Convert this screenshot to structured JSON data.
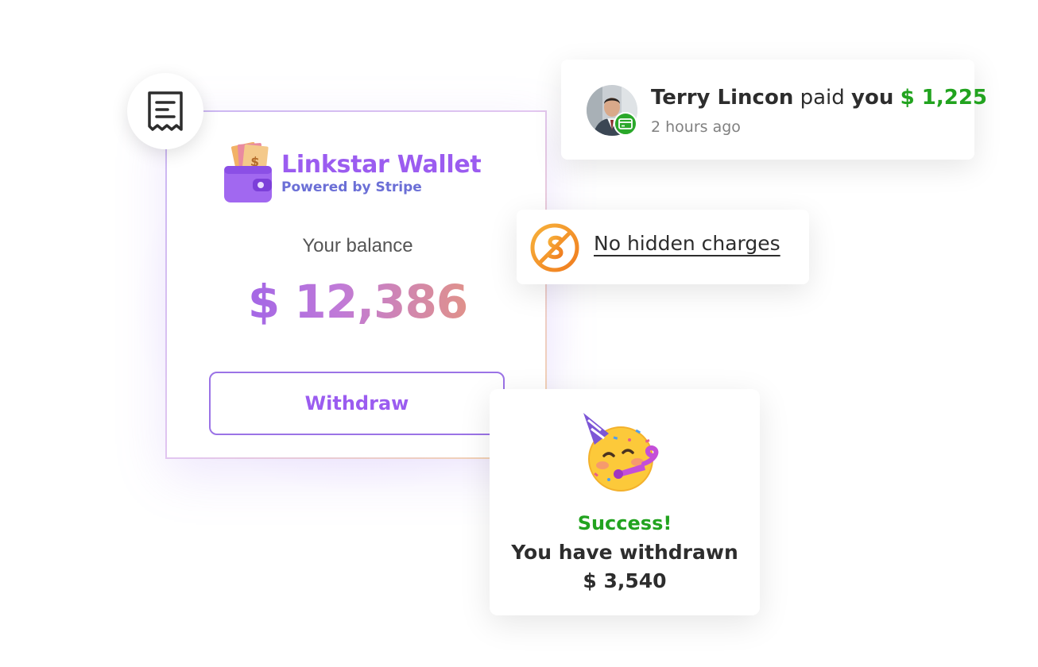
{
  "wallet": {
    "brand_name": "Linkstar Wallet",
    "brand_sub": "Powered by Stripe",
    "balance_label": "Your balance",
    "balance_value": "$ 12,386",
    "withdraw_label": "Withdraw",
    "receipt_icon": "receipt-icon",
    "wallet_icon": "wallet-logo-icon"
  },
  "notification": {
    "name": "Terry Lincon",
    "action": "paid",
    "you": "you",
    "amount": "$ 1,225",
    "time": "2 hours ago",
    "badge_icon": "credit-card-icon"
  },
  "charges": {
    "label": "No hidden charges",
    "icon": "no-dollar-icon"
  },
  "success": {
    "title": "Success!",
    "message": "You have withdrawn",
    "amount": "$ 3,540",
    "icon": "party-face-icon"
  },
  "colors": {
    "brand_purple": "#9b5cf0",
    "success_green": "#22a31f",
    "accent_orange": "#f59a2b"
  }
}
